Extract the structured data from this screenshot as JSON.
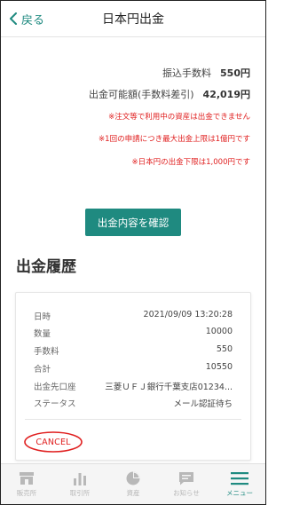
{
  "header": {
    "back_label": "戻る",
    "title": "日本円出金"
  },
  "summary": {
    "fee_label": "振込手数料",
    "fee_value": "550円",
    "available_label": "出金可能額(手数料差引)",
    "available_value": "42,019円",
    "notes": [
      "※注文等で利用中の資産は出金できません",
      "※1回の申請につき最大出金上限は1億円です",
      "※日本円の出金下限は1,000円です"
    ],
    "confirm_button": "出金内容を確認"
  },
  "history": {
    "title": "出金履歴",
    "record": [
      {
        "label": "日時",
        "value": "2021/09/09 13:20:28"
      },
      {
        "label": "数量",
        "value": "10000"
      },
      {
        "label": "手数料",
        "value": "550"
      },
      {
        "label": "合計",
        "value": "10550"
      },
      {
        "label": "出金先口座",
        "value": "三菱ＵＦＪ銀行千葉支店01234..."
      },
      {
        "label": "ステータス",
        "value": "メール認証待ち"
      }
    ],
    "cancel_label": "CANCEL"
  },
  "bottom_nav": [
    {
      "label": "販売所",
      "icon": "shop-icon",
      "active": false
    },
    {
      "label": "取引所",
      "icon": "bar-chart-icon",
      "active": false
    },
    {
      "label": "資産",
      "icon": "pie-chart-icon",
      "active": false
    },
    {
      "label": "お知らせ",
      "icon": "message-icon",
      "active": false
    },
    {
      "label": "メニュー",
      "icon": "menu-icon",
      "active": true
    }
  ],
  "colors": {
    "accent": "#1f8a80",
    "warning": "#e02020",
    "nav_inactive": "#b8b8b8"
  }
}
